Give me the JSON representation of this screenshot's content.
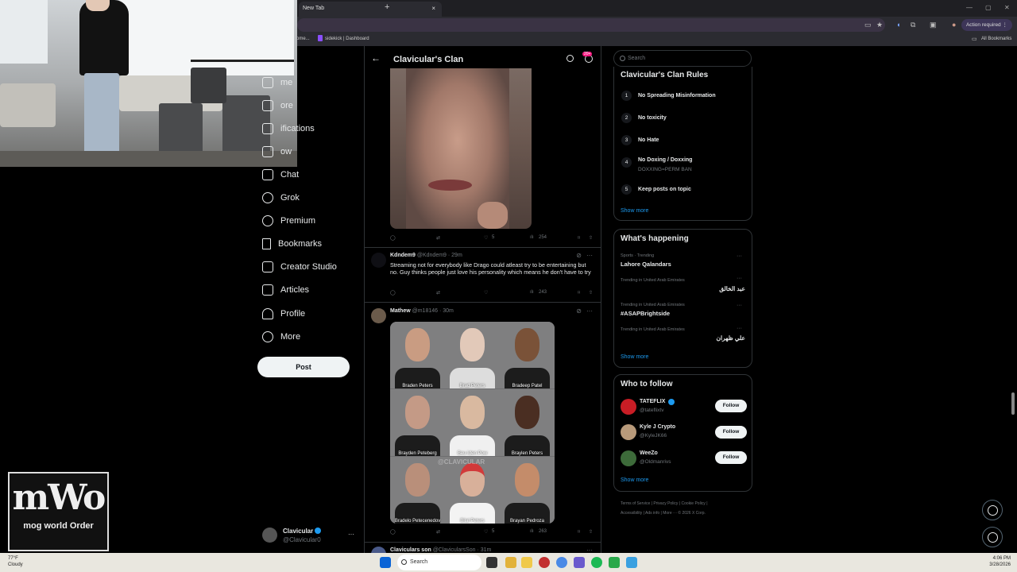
{
  "browser": {
    "tab_title": "New Tab",
    "tab_close": "×",
    "new_tab": "+",
    "action_required": "Action required",
    "bookmarks_bar": [
      "come...",
      "sidekick | Dashboard"
    ],
    "all_bookmarks": "All Bookmarks",
    "window_controls": [
      "—",
      "▢",
      "✕"
    ]
  },
  "nav": {
    "items": [
      {
        "label": "me",
        "icon": "home-icon"
      },
      {
        "label": "ore",
        "icon": "explore-icon"
      },
      {
        "label": "ifications",
        "icon": "bell-icon"
      },
      {
        "label": "ow",
        "icon": "follow-icon"
      },
      {
        "label": "Chat",
        "icon": "chat-icon"
      },
      {
        "label": "Grok",
        "icon": "grok-icon"
      },
      {
        "label": "Premium",
        "icon": "premium-icon"
      },
      {
        "label": "Bookmarks",
        "icon": "bookmark-icon"
      },
      {
        "label": "Creator Studio",
        "icon": "creator-studio-icon"
      },
      {
        "label": "Articles",
        "icon": "articles-icon"
      },
      {
        "label": "Profile",
        "icon": "profile-icon"
      },
      {
        "label": "More",
        "icon": "more-icon"
      }
    ],
    "post_button": "Post",
    "account": {
      "name": "Clavicular",
      "handle": "@Clavicular0",
      "more": "···"
    }
  },
  "community": {
    "title": "Clavicular's Clan",
    "notif_badge": "20+",
    "back": "←"
  },
  "posts": [
    {
      "stats": {
        "likes": "5",
        "views": "254"
      }
    },
    {
      "author": "Kdndem9",
      "handle_time": "@Kdndem9 · 29m",
      "text": "Streaming not for everybody like Drago could atleast try to be entertaining but no. Guy thinks people just love his personality which means he don't have to try",
      "stats": {
        "views": "243"
      }
    },
    {
      "author": "Mathew",
      "handle_time": "@m18146 · 30m",
      "mugshots": [
        "Braden Peters",
        "Brad Peters",
        "Bradeep Patel",
        "Brayden Peteberg",
        "Beu Iden Pow",
        "Braylen Peters",
        "Bradelo Petecenedov",
        "Bilal Peters",
        "Brayan Pedroza"
      ],
      "watermark": "@CLAVICULAR",
      "stats": {
        "likes": "5",
        "views": "263"
      }
    },
    {
      "author": "Claviculars son",
      "handle_time": "@ClavicularsSon · 31m"
    }
  ],
  "right": {
    "search_placeholder": "Search",
    "rules_title": "Clavicular's Clan Rules",
    "rules": [
      {
        "n": "1",
        "title": "No Spreading Misinformation",
        "sub": ""
      },
      {
        "n": "2",
        "title": "No toxicity",
        "sub": ""
      },
      {
        "n": "3",
        "title": "No Hate",
        "sub": ""
      },
      {
        "n": "4",
        "title": "No Doxing / Doxxing",
        "sub": "DOXXING=PERM BAN"
      },
      {
        "n": "5",
        "title": "Keep posts on topic",
        "sub": ""
      }
    ],
    "show_more": "Show more",
    "happening_title": "What's happening",
    "trends": [
      {
        "meta": "Sports · Trending",
        "name": "Lahore Qalandars"
      },
      {
        "meta": "Trending in United Arab Emirates",
        "name": "عبد الخالق"
      },
      {
        "meta": "Trending in United Arab Emirates",
        "name": "#ASAPBrightside"
      },
      {
        "meta": "Trending in United Arab Emirates",
        "name": "علي ظهران"
      }
    ],
    "wtf_title": "Who to follow",
    "follow_label": "Follow",
    "who_to_follow": [
      {
        "name": "TATEFLIX",
        "handle": "@tateflixtv"
      },
      {
        "name": "Kyle J Crypto",
        "handle": "@KyleJK66"
      },
      {
        "name": "WeeZo",
        "handle": "@Oldmanrivs"
      }
    ],
    "footer": [
      "Terms of Service",
      "Privacy Policy",
      "Cookie Policy",
      "Accessibility",
      "Ads info",
      "More ···",
      "© 2026 X Corp."
    ]
  },
  "logo": {
    "big": "mWo",
    "small": "mog world Order"
  },
  "taskbar": {
    "weather_temp": "77°F",
    "weather_cond": "Cloudy",
    "search": "Search",
    "time": "4:06 PM",
    "date": "3/28/2026"
  }
}
